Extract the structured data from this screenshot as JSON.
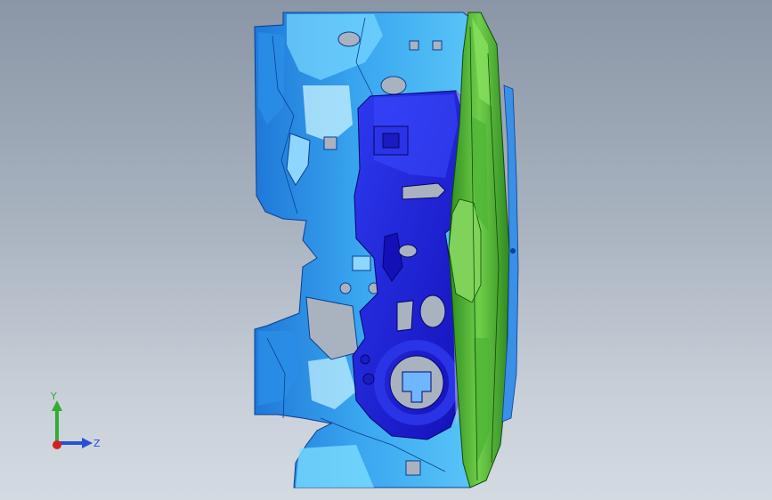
{
  "view": {
    "background_top": "#8a96a6",
    "background_bottom": "#d4dae2"
  },
  "model": {
    "parts": [
      {
        "name": "cyan-casting-body",
        "color": "#3aa7f0",
        "highlight": "#7fe0ff"
      },
      {
        "name": "blue-insert-block",
        "color": "#1b1fd6",
        "highlight": "#4a56ff"
      },
      {
        "name": "green-cover-plate",
        "color": "#3fa82a",
        "highlight": "#7fd35a"
      }
    ]
  },
  "triad": {
    "y_label": "Y",
    "z_label": "Z",
    "y_color": "#2fae2f",
    "z_color": "#2a4fd6",
    "x_color": "#d42020"
  }
}
